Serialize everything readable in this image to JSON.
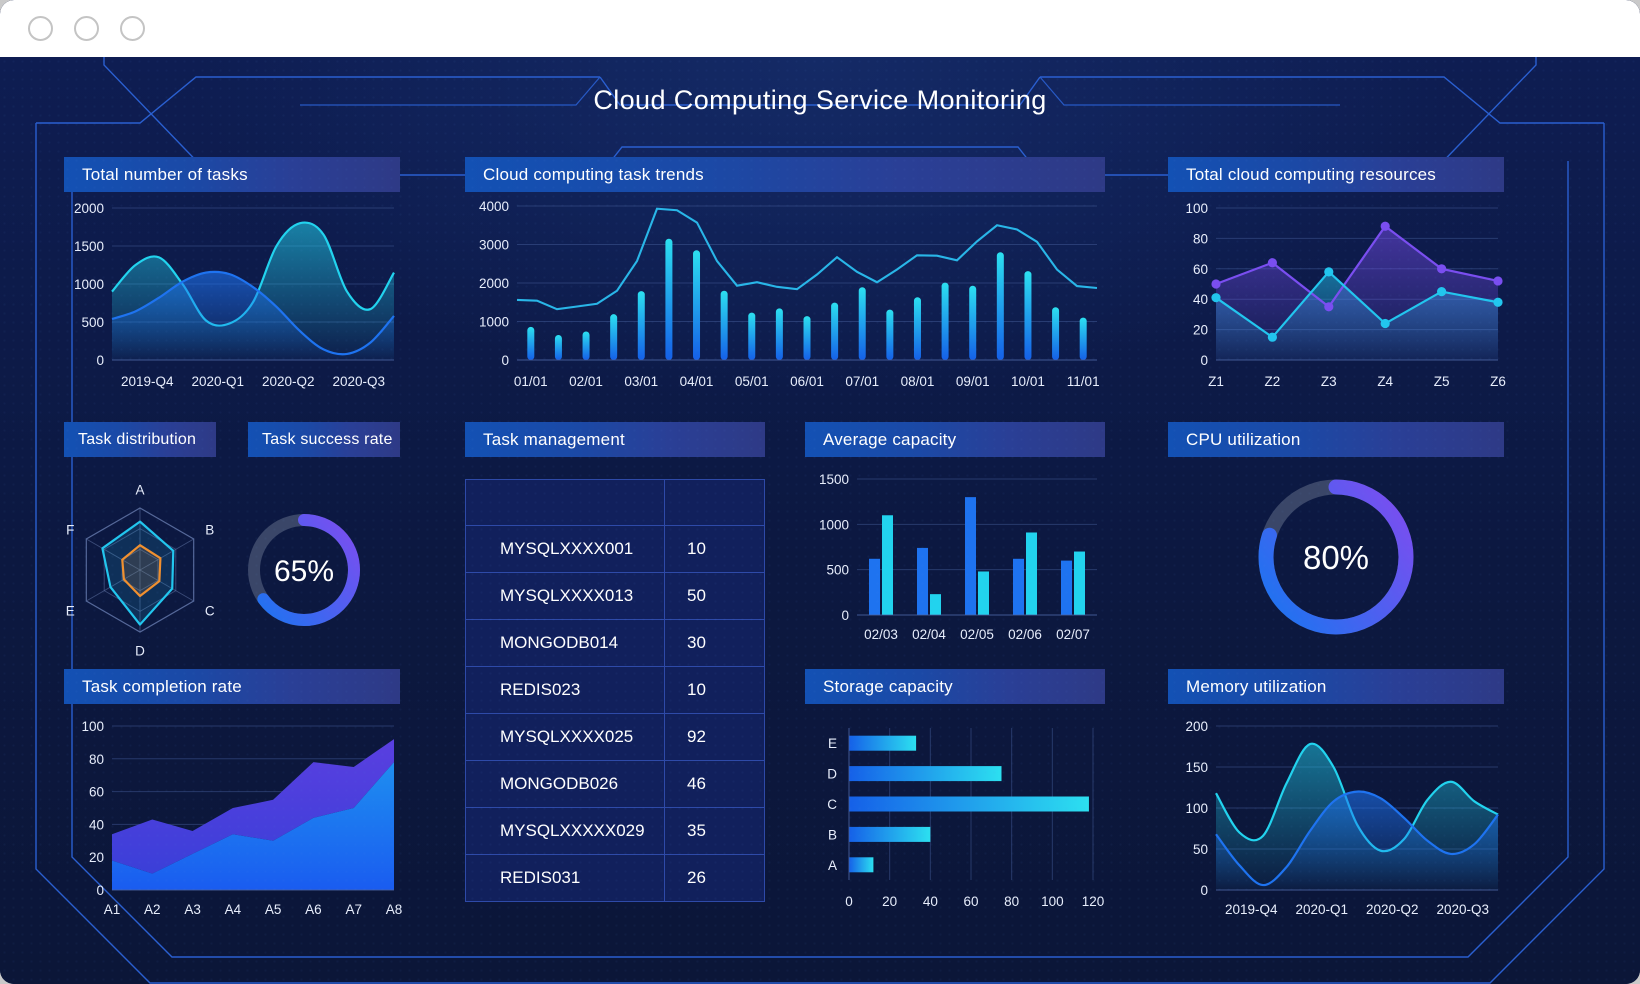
{
  "window": {
    "controls": [
      "window-dot-1",
      "window-dot-2",
      "window-dot-3"
    ]
  },
  "header": {
    "title": "Cloud Computing Service Monitoring"
  },
  "colors": {
    "background": "#0d1b4b",
    "panel_header_from": "#1351b4",
    "panel_header_to": "#2e3a86",
    "cyan": "#22d3ee",
    "blue": "#1e73f0",
    "purple": "#6d4cf0",
    "orange": "#f0902f",
    "gauge_track": "#3a4668",
    "grid": "#3f5691",
    "text": "#ffffff"
  },
  "panels": {
    "total_tasks": {
      "title": "Total number of tasks"
    },
    "task_trends": {
      "title": "Cloud computing task trends"
    },
    "total_resources": {
      "title": "Total cloud computing resources"
    },
    "task_distribution": {
      "title": "Task distribution"
    },
    "task_success_rate": {
      "title": "Task success rate"
    },
    "task_management": {
      "title": "Task management"
    },
    "average_capacity": {
      "title": "Average capacity"
    },
    "cpu_utilization": {
      "title": "CPU utilization"
    },
    "task_completion_rate": {
      "title": "Task completion rate"
    },
    "storage_capacity": {
      "title": "Storage capacity"
    },
    "memory_utilization": {
      "title": "Memory utilization"
    }
  },
  "task_management_table": {
    "header": [
      "",
      ""
    ],
    "rows": [
      {
        "name": "MYSQLXXXX001",
        "value": "10"
      },
      {
        "name": "MYSQLXXXX013",
        "value": "50"
      },
      {
        "name": "MONGODB014",
        "value": "30"
      },
      {
        "name": "REDIS023",
        "value": "10"
      },
      {
        "name": "MYSQLXXXX025",
        "value": "92"
      },
      {
        "name": "MONGODB026",
        "value": "46"
      },
      {
        "name": "MYSQLXXXXX029",
        "value": "35"
      },
      {
        "name": "REDIS031",
        "value": "26"
      }
    ]
  },
  "chart_data": [
    {
      "id": "total_tasks",
      "type": "area",
      "title": "Total number of tasks",
      "categories": [
        "2019-Q4",
        "2020-Q1",
        "2020-Q2",
        "2020-Q3"
      ],
      "x": [
        0,
        1,
        2,
        3,
        4,
        5,
        6,
        7,
        8,
        9,
        10,
        11,
        12
      ],
      "ylim": [
        0,
        2000
      ],
      "yticks": [
        0,
        500,
        1000,
        1500,
        2000
      ],
      "grid": true,
      "legend": "none",
      "series": [
        {
          "name": "series-cyan",
          "color": "#22d3ee",
          "values": [
            900,
            1250,
            1350,
            1000,
            520,
            480,
            760,
            1500,
            1800,
            1650,
            900,
            670,
            1150
          ]
        },
        {
          "name": "series-blue",
          "color": "#1e73f0",
          "values": [
            540,
            640,
            820,
            1030,
            1150,
            1130,
            960,
            700,
            380,
            140,
            80,
            230,
            580
          ]
        }
      ]
    },
    {
      "id": "task_trends",
      "type": "bar",
      "title": "Cloud computing task trends",
      "categories": [
        "01/01",
        "",
        "02/01",
        "",
        "03/01",
        "",
        "04/01",
        "",
        "05/01",
        "",
        "06/01",
        "",
        "07/01",
        "",
        "08/01",
        "",
        "09/01",
        "",
        "10/01",
        "",
        "11/01"
      ],
      "xtick_labels": [
        "01/01",
        "02/01",
        "03/01",
        "04/01",
        "05/01",
        "06/01",
        "07/01",
        "08/01",
        "09/01",
        "10/01",
        "11/01"
      ],
      "ylim": [
        0,
        4000
      ],
      "yticks": [
        0,
        1000,
        2000,
        3000,
        4000
      ],
      "grid": true,
      "bar_values": [
        860,
        650,
        740,
        1190,
        1790,
        3150,
        2850,
        1800,
        1230,
        1340,
        1140,
        1490,
        1890,
        1310,
        1630,
        2010,
        1930,
        2800,
        2310,
        1370,
        1100
      ],
      "line_values": [
        1560,
        1540,
        1320,
        1390,
        1460,
        1800,
        2570,
        3930,
        3890,
        3570,
        2570,
        1930,
        2020,
        1900,
        1840,
        2220,
        2670,
        2290,
        2020,
        2350,
        2720,
        2710,
        2590,
        3080,
        3500,
        3390,
        3070,
        2350,
        1920,
        1870
      ],
      "series": [
        {
          "name": "task-bars",
          "color": "#1e73f0"
        },
        {
          "name": "task-line",
          "color": "#29b6e8"
        }
      ]
    },
    {
      "id": "total_resources",
      "type": "line",
      "title": "Total cloud computing resources",
      "categories": [
        "Z1",
        "Z2",
        "Z3",
        "Z4",
        "Z5",
        "Z6"
      ],
      "ylim": [
        0,
        100
      ],
      "yticks": [
        0,
        20,
        40,
        60,
        80,
        100
      ],
      "grid": true,
      "markers": true,
      "series": [
        {
          "name": "resources-purple",
          "color": "#7a4ef0",
          "values": [
            50,
            64,
            35,
            88,
            60,
            52
          ]
        },
        {
          "name": "resources-cyan",
          "color": "#22c6ee",
          "values": [
            41,
            15,
            58,
            24,
            45,
            38
          ]
        }
      ]
    },
    {
      "id": "task_distribution",
      "type": "radar",
      "title": "Task distribution",
      "axes": [
        "A",
        "B",
        "C",
        "D",
        "E",
        "F"
      ],
      "max": 100,
      "rings": 3,
      "series": [
        {
          "name": "radar-outer",
          "color": "#22c6ee",
          "values": [
            78,
            62,
            60,
            88,
            55,
            70
          ]
        },
        {
          "name": "radar-inner",
          "color": "#f0902f",
          "values": [
            40,
            38,
            36,
            42,
            30,
            33
          ]
        }
      ]
    },
    {
      "id": "task_success_rate",
      "type": "pie",
      "title": "Task success rate",
      "value": 65,
      "label": "65%",
      "track_color": "#3a4668",
      "arc_from": "#1e73f0",
      "arc_to": "#7a4ef0"
    },
    {
      "id": "average_capacity",
      "type": "bar",
      "title": "Average capacity",
      "categories": [
        "02/03",
        "02/04",
        "02/05",
        "02/06",
        "02/07"
      ],
      "ylim": [
        0,
        1500
      ],
      "yticks": [
        0,
        500,
        1000,
        1500
      ],
      "grid": true,
      "series": [
        {
          "name": "capacity-blue",
          "color": "#1e73f0",
          "values": [
            620,
            740,
            1300,
            620,
            600
          ]
        },
        {
          "name": "capacity-cyan",
          "color": "#22d3ee",
          "values": [
            1100,
            230,
            480,
            910,
            700
          ]
        }
      ]
    },
    {
      "id": "cpu_utilization",
      "type": "pie",
      "title": "CPU utilization",
      "value": 80,
      "label": "80%",
      "track_color": "#3a4668",
      "arc_from": "#1e73f0",
      "arc_to": "#7a4ef0"
    },
    {
      "id": "task_completion_rate",
      "type": "area",
      "title": "Task completion rate",
      "categories": [
        "A1",
        "A2",
        "A3",
        "A4",
        "A5",
        "A6",
        "A7",
        "A8"
      ],
      "ylim": [
        0,
        100
      ],
      "yticks": [
        0,
        20,
        40,
        60,
        80,
        100
      ],
      "grid": true,
      "stacked": true,
      "series": [
        {
          "name": "completion-lower",
          "color": "#1e73f0",
          "values": [
            18,
            10,
            22,
            34,
            30,
            44,
            50,
            78
          ]
        },
        {
          "name": "completion-upper",
          "color": "#4b3bd6",
          "values": [
            34,
            43,
            36,
            50,
            55,
            78,
            75,
            92
          ]
        }
      ]
    },
    {
      "id": "storage_capacity",
      "type": "bar",
      "orientation": "horizontal",
      "title": "Storage capacity",
      "categories": [
        "E",
        "D",
        "C",
        "B",
        "A"
      ],
      "xlim": [
        0,
        120
      ],
      "xticks": [
        0,
        20,
        40,
        60,
        80,
        100,
        120
      ],
      "grid": true,
      "values": [
        33,
        75,
        118,
        40,
        12
      ],
      "series": [
        {
          "name": "storage-bars",
          "color": "#1e73f0"
        }
      ]
    },
    {
      "id": "memory_utilization",
      "type": "area",
      "title": "Memory utilization",
      "categories": [
        "2019-Q4",
        "2020-Q1",
        "2020-Q2",
        "2020-Q3"
      ],
      "ylim": [
        0,
        200
      ],
      "yticks": [
        0,
        50,
        100,
        150,
        200
      ],
      "grid": true,
      "series": [
        {
          "name": "memory-cyan",
          "color": "#22d3ee",
          "values": [
            118,
            70,
            66,
            130,
            178,
            150,
            80,
            48,
            62,
            110,
            132,
            108,
            92
          ]
        },
        {
          "name": "memory-blue",
          "color": "#1e73f0",
          "values": [
            68,
            30,
            6,
            28,
            72,
            108,
            120,
            112,
            88,
            60,
            44,
            56,
            92
          ]
        }
      ]
    }
  ]
}
